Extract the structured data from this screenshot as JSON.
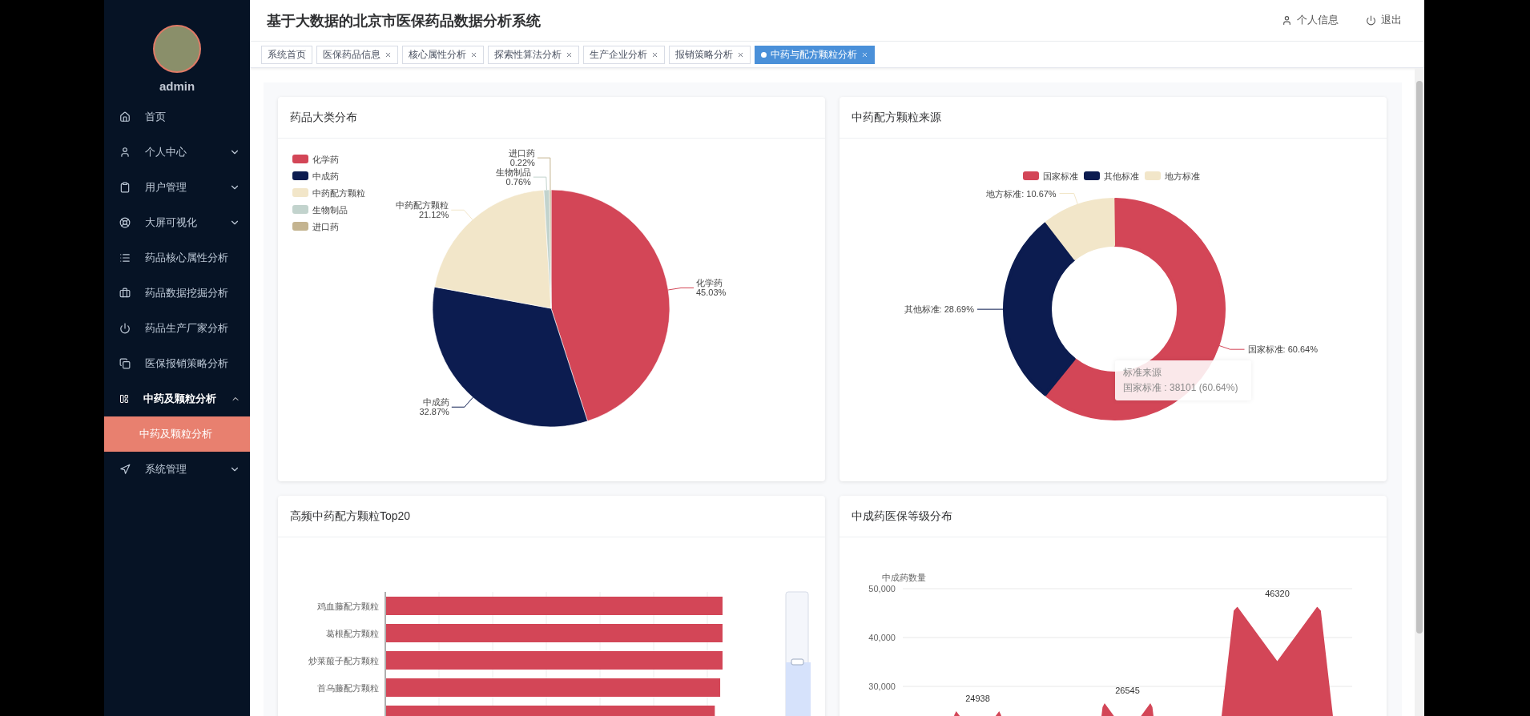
{
  "header": {
    "title": "基于大数据的北京市医保药品数据分析系统",
    "profile_link": "个人信息",
    "logout_link": "退出"
  },
  "sidebar": {
    "user": "admin",
    "items": [
      {
        "label": "首页",
        "kind": "item",
        "expanded": false
      },
      {
        "label": "个人中心",
        "kind": "menu",
        "expanded": false
      },
      {
        "label": "用户管理",
        "kind": "menu",
        "expanded": false
      },
      {
        "label": "大屏可视化",
        "kind": "menu",
        "expanded": false
      },
      {
        "label": "药品核心属性分析",
        "kind": "item",
        "expanded": false
      },
      {
        "label": "药品数据挖掘分析",
        "kind": "item",
        "expanded": false
      },
      {
        "label": "药品生产厂家分析",
        "kind": "item",
        "expanded": false
      },
      {
        "label": "医保报销策略分析",
        "kind": "item",
        "expanded": false
      },
      {
        "label": "中药及颗粒分析",
        "kind": "menu",
        "expanded": true,
        "children": [
          {
            "label": "中药及颗粒分析",
            "selected": true
          }
        ]
      },
      {
        "label": "系统管理",
        "kind": "menu",
        "expanded": false
      }
    ]
  },
  "tabs": [
    {
      "label": "系统首页",
      "closable": false,
      "selected": false
    },
    {
      "label": "医保药品信息",
      "closable": true,
      "selected": false
    },
    {
      "label": "核心属性分析",
      "closable": true,
      "selected": false
    },
    {
      "label": "探索性算法分析",
      "closable": true,
      "selected": false
    },
    {
      "label": "生产企业分析",
      "closable": true,
      "selected": false
    },
    {
      "label": "报销策略分析",
      "closable": true,
      "selected": false
    },
    {
      "label": "中药与配方颗粒分析",
      "closable": true,
      "selected": true
    }
  ],
  "category_chart": {
    "title": "药品大类分布",
    "chart_data": {
      "type": "pie",
      "legend": "left",
      "categories": [
        "化学药",
        "中成药",
        "中药配方颗粒",
        "生物制品",
        "进口药"
      ],
      "values": [
        45.03,
        32.87,
        21.12,
        0.76,
        0.22
      ],
      "value_labels": [
        "45.03%",
        "32.87%",
        "21.12%",
        "0.76%",
        "0.22%"
      ]
    }
  },
  "source_chart": {
    "title": "中药配方颗粒来源",
    "chart_data": {
      "type": "donut",
      "legend": "top",
      "categories": [
        "国家标准",
        "其他标准",
        "地方标准"
      ],
      "values": [
        60.64,
        28.69,
        10.67
      ],
      "value_labels": [
        "国家标准: 60.64%",
        "其他标准: 28.69%",
        "地方标准: 10.67%"
      ]
    },
    "tooltip": {
      "title": "标准来源",
      "text": "国家标准 : 38101 (60.64%)"
    }
  },
  "top20_chart": {
    "title": "高频中药配方颗粒Top20",
    "labels": [
      "鸡血藤配方颗粒",
      "葛根配方颗粒",
      "炒莱菔子配方颗粒",
      "首乌藤配方颗粒"
    ]
  },
  "grade_chart": {
    "title": "中成药医保等级分布",
    "chart_data": {
      "type": "bar",
      "ylim": [
        0,
        50000
      ],
      "ylabel": "中成药数量",
      "values": [
        24938,
        26545,
        46320
      ],
      "value_labels": [
        "24938",
        "26545",
        "46320"
      ],
      "yticks": [
        {
          "value": 30000,
          "label": "30,000"
        },
        {
          "value": 40000,
          "label": "40,000"
        },
        {
          "value": 50000,
          "label": "50,000"
        }
      ]
    }
  }
}
